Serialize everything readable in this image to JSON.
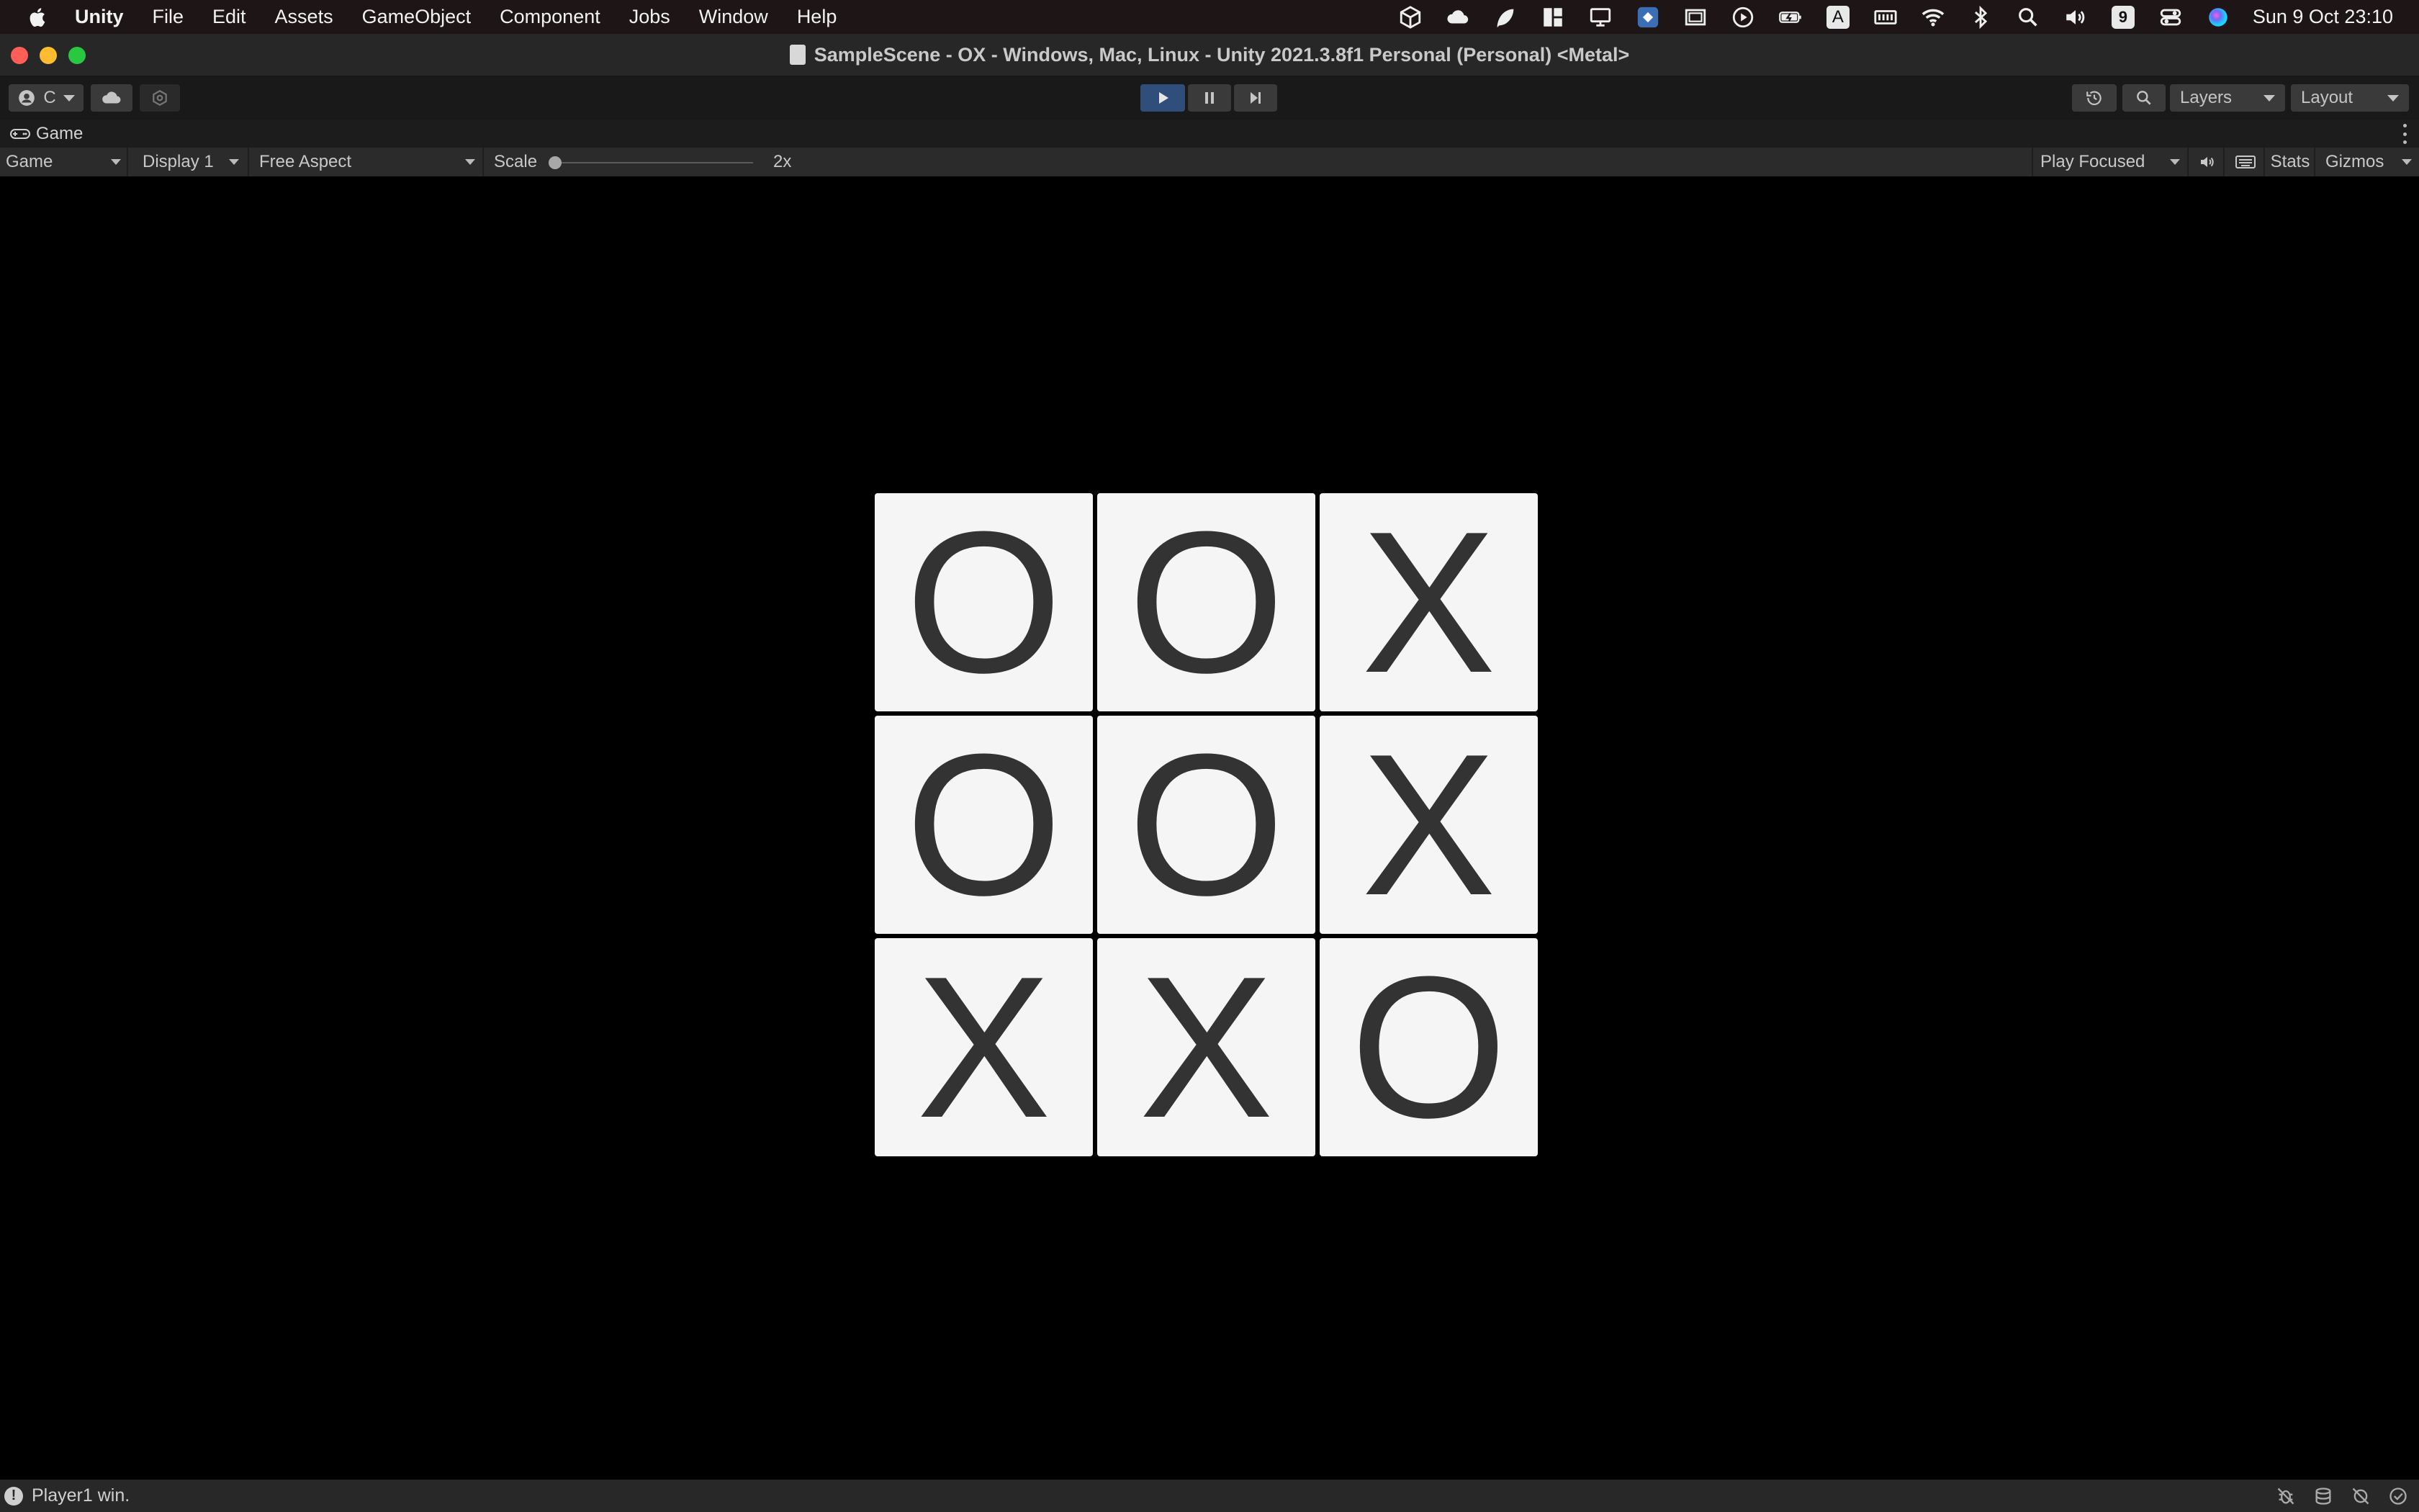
{
  "menubar": {
    "app_name": "Unity",
    "items": [
      "File",
      "Edit",
      "Assets",
      "GameObject",
      "Component",
      "Jobs",
      "Window",
      "Help"
    ],
    "clock": "Sun 9 Oct  23:10",
    "badge_a": "A",
    "badge_9": "9",
    "status_icons": [
      "unity-hub-icon",
      "cloud-icon",
      "leaf-icon",
      "layout-icon",
      "display-icon",
      "app-icon",
      "window-icon",
      "play-circle-icon",
      "battery-icon",
      "keyboard-input-icon",
      "memory-icon",
      "wifi-icon",
      "bluetooth-icon",
      "spotlight-icon",
      "volume-icon",
      "calendar-badge-icon",
      "control-center-icon",
      "siri-icon"
    ]
  },
  "window": {
    "title": "SampleScene - OX - Windows, Mac, Linux - Unity 2021.3.8f1 Personal (Personal) <Metal>"
  },
  "toolbar": {
    "account_label": "C",
    "layers_label": "Layers",
    "layout_label": "Layout",
    "play_color": "#2f4f7a"
  },
  "game_view": {
    "tab_label": "Game",
    "mode_label": "Game",
    "display_label": "Display 1",
    "aspect_label": "Free Aspect",
    "scale_label": "Scale",
    "scale_value": "2x",
    "play_focused_label": "Play Focused",
    "stats_label": "Stats",
    "gizmos_label": "Gizmos"
  },
  "board": {
    "cells": [
      "O",
      "O",
      "X",
      "O",
      "O",
      "X",
      "X",
      "X",
      "O"
    ],
    "cell_color": "#f5f5f5",
    "mark_color": "#333333"
  },
  "status": {
    "message": "Player1 win."
  }
}
